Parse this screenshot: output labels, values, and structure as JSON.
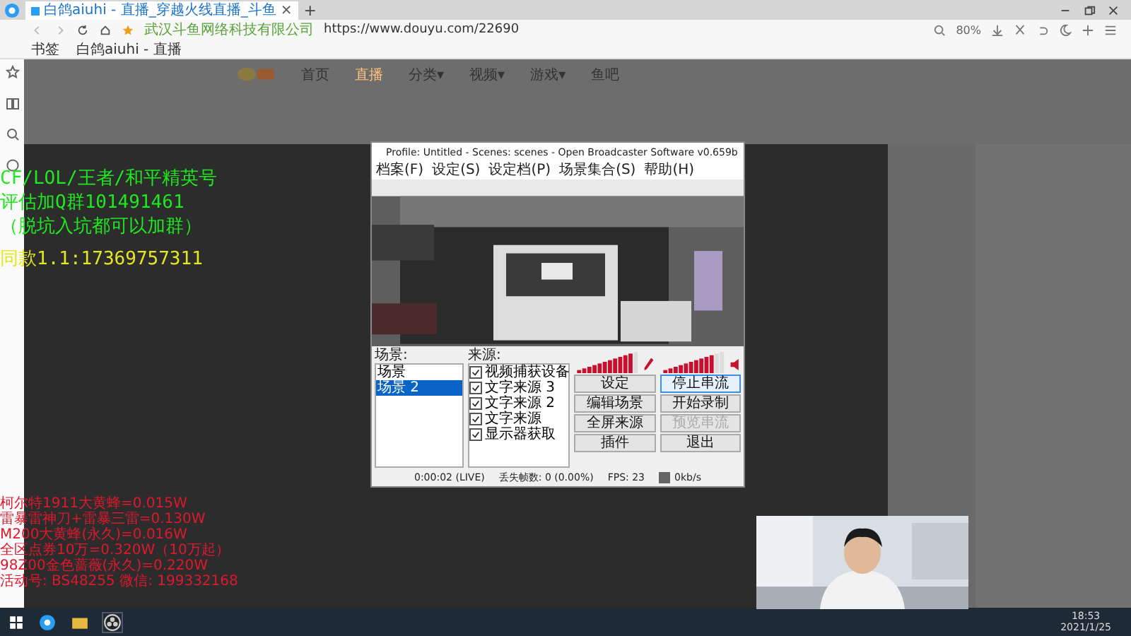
{
  "browser": {
    "tab_title": "白鸽aiuhi - 直播_穿越火线直播_斗鱼",
    "tab_close": "×",
    "new_tab": "+",
    "site_owner": "武汉斗鱼网络科技有限公司",
    "url": "https://www.douyu.com/22690",
    "zoom": "80%",
    "bookmarks": [
      {
        "label": "书签"
      },
      {
        "label": "白鸽aiuhi - 直播"
      }
    ]
  },
  "site_nav": [
    {
      "label": "首页",
      "selected": false
    },
    {
      "label": "直播",
      "selected": true
    },
    {
      "label": "分类▾",
      "selected": false
    },
    {
      "label": "视频▾",
      "selected": false
    },
    {
      "label": "游戏▾",
      "selected": false
    },
    {
      "label": "鱼吧",
      "selected": false
    }
  ],
  "overlay": {
    "green_lines": [
      "CF/LOL/王者/和平精英号",
      "评估加Q群101491461",
      "（脱坑入坑都可以加群）"
    ],
    "yellow_line": "同款1.1:17369757311",
    "red_lines": [
      "柯尔特1911大黄蜂=0.015W",
      "雷暴雷神刀+雷暴三雷=0.130W",
      "M200大黄蜂(永久)=0.016W",
      "全区点券10万=0.320W（10万起）",
      "98Z00金色蔷薇(永久)=0.220W",
      "活动号: BS48255  微信: 199332168"
    ]
  },
  "obs": {
    "title": "Profile: Untitled - Scenes: scenes - Open Broadcaster Software v0.659b",
    "menu": [
      "档案(F)",
      "设定(S)",
      "设定档(P)",
      "场景集合(S)",
      "帮助(H)"
    ],
    "scenes_label": "场景:",
    "scenes": [
      {
        "name": "场景",
        "selected": false
      },
      {
        "name": "场景 2",
        "selected": true
      }
    ],
    "sources_label": "来源:",
    "sources": [
      {
        "name": "视频捕获设备",
        "checked": true
      },
      {
        "name": "文字来源 3",
        "checked": true
      },
      {
        "name": "文字来源 2",
        "checked": true
      },
      {
        "name": "文字来源",
        "checked": true
      },
      {
        "name": "显示器获取",
        "checked": true
      }
    ],
    "meters": [
      {
        "kind": "mic",
        "level": 0.9
      },
      {
        "kind": "speaker",
        "level": 0.85
      }
    ],
    "buttons": [
      {
        "label": "设定",
        "disabled": false,
        "selected": false
      },
      {
        "label": "停止串流",
        "disabled": false,
        "selected": true
      },
      {
        "label": "编辑场景",
        "disabled": false,
        "selected": false
      },
      {
        "label": "开始录制",
        "disabled": false,
        "selected": false
      },
      {
        "label": "全屏来源",
        "disabled": false,
        "selected": false
      },
      {
        "label": "预览串流",
        "disabled": true,
        "selected": false
      },
      {
        "label": "插件",
        "disabled": false,
        "selected": false
      },
      {
        "label": "退出",
        "disabled": false,
        "selected": false
      }
    ],
    "status": [
      "0:00:02 (LIVE)",
      "丢失帧数: 0 (0.00%)",
      "FPS: 23",
      "0kb/s"
    ]
  },
  "taskbar": {
    "time": "18:53",
    "date": "2021/1/25"
  }
}
